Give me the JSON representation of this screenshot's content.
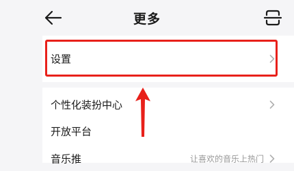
{
  "header": {
    "title": "更多",
    "back_icon": "arrow-left-icon",
    "scan_icon": "scan-icon"
  },
  "settings_row": {
    "label": "设置"
  },
  "menu": {
    "items": [
      {
        "label": "个性化装扮中心",
        "hint": ""
      },
      {
        "label": "开放平台",
        "hint": ""
      },
      {
        "label": "音乐推",
        "hint": "让喜欢的音乐上热门"
      }
    ]
  },
  "annotation": {
    "highlight_color": "#e8201a"
  },
  "colors": {
    "background": "#f5f5f7",
    "card": "#ffffff",
    "text_primary": "#1a1a1a",
    "text_secondary": "#999999",
    "chevron": "#b0b0b0"
  }
}
